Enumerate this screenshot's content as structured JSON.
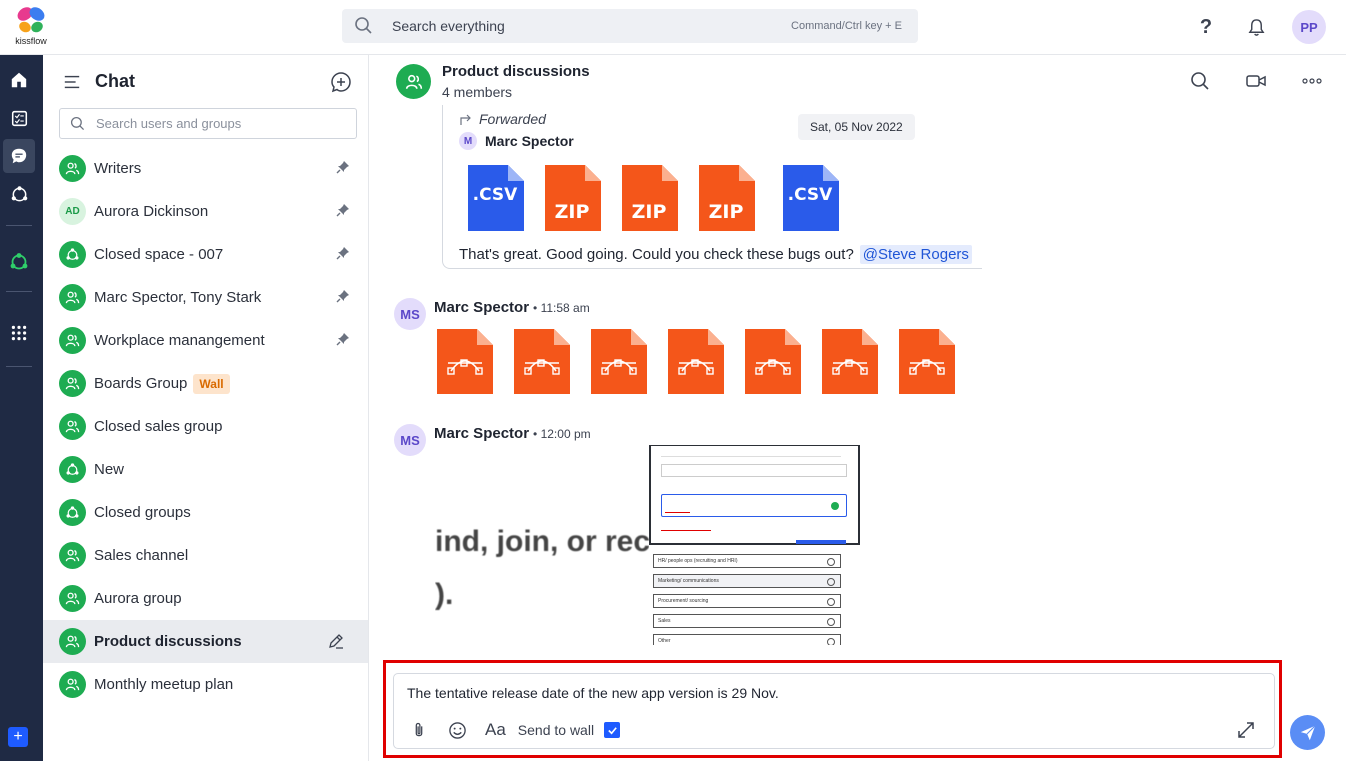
{
  "app": {
    "logo_text": "kissflow",
    "search_placeholder": "Search everything",
    "search_hint": "Command/Ctrl key + E",
    "help_glyph": "?",
    "user_initials": "PP"
  },
  "chat_panel": {
    "title": "Chat",
    "search_placeholder": "Search users and groups",
    "items": [
      {
        "name": "Writers",
        "icon": "group-icon",
        "pinned": true
      },
      {
        "name": "Aurora Dickinson",
        "icon": "initials",
        "initials": "AD",
        "pinned": true
      },
      {
        "name": "Closed space - 007",
        "icon": "space-icon",
        "pinned": true
      },
      {
        "name": "Marc Spector, Tony Stark",
        "icon": "group-icon",
        "pinned": true
      },
      {
        "name": "Workplace manangement",
        "icon": "group-icon",
        "pinned": true
      },
      {
        "name": "Boards Group",
        "icon": "group-icon",
        "badge": "Wall"
      },
      {
        "name": "Closed sales group",
        "icon": "group-icon"
      },
      {
        "name": "New",
        "icon": "space-icon"
      },
      {
        "name": "Closed groups",
        "icon": "space-icon"
      },
      {
        "name": "Sales channel",
        "icon": "group-icon"
      },
      {
        "name": "Aurora group",
        "icon": "group-icon"
      },
      {
        "name": "Product discussions",
        "icon": "group-icon",
        "selected": true
      },
      {
        "name": "Monthly meetup plan",
        "icon": "group-icon"
      }
    ]
  },
  "conversation": {
    "title": "Product discussions",
    "subtitle": "4 members",
    "forwarded": {
      "label": "Forwarded",
      "author_initial": "M",
      "author": "Marc Spector",
      "date": "Sat, 05 Nov 2022",
      "files": [
        ".CSV",
        "ZIP",
        "ZIP",
        "ZIP",
        ".CSV"
      ],
      "text": "That's great. Good going. Could you check these bugs out?",
      "mention": "@Steve Rogers"
    },
    "messages": [
      {
        "initials": "MS",
        "author": "Marc Spector",
        "time": "• 11:58 am",
        "vector_files": 7
      },
      {
        "initials": "MS",
        "author": "Marc Spector",
        "time": "• 12:00 pm",
        "image_text_line1": "ind, join, or rec",
        "image_text_line2": ").",
        "image_options": [
          "HR/ people ops (recruiting and HRI)",
          "Marketing/ communications",
          "Procurement/ sourcing",
          "Sales",
          "Other"
        ]
      }
    ]
  },
  "composer": {
    "text": "The tentative release date of the new app version is 29 Nov.",
    "format_label": "Aa",
    "send_to_wall_label": "Send to wall",
    "send_to_wall_checked": true
  },
  "colors": {
    "accent": "#1e5bff",
    "group_green": "#1eac52",
    "rail_bg": "#1f2a44",
    "highlight_red": "#e00000"
  }
}
